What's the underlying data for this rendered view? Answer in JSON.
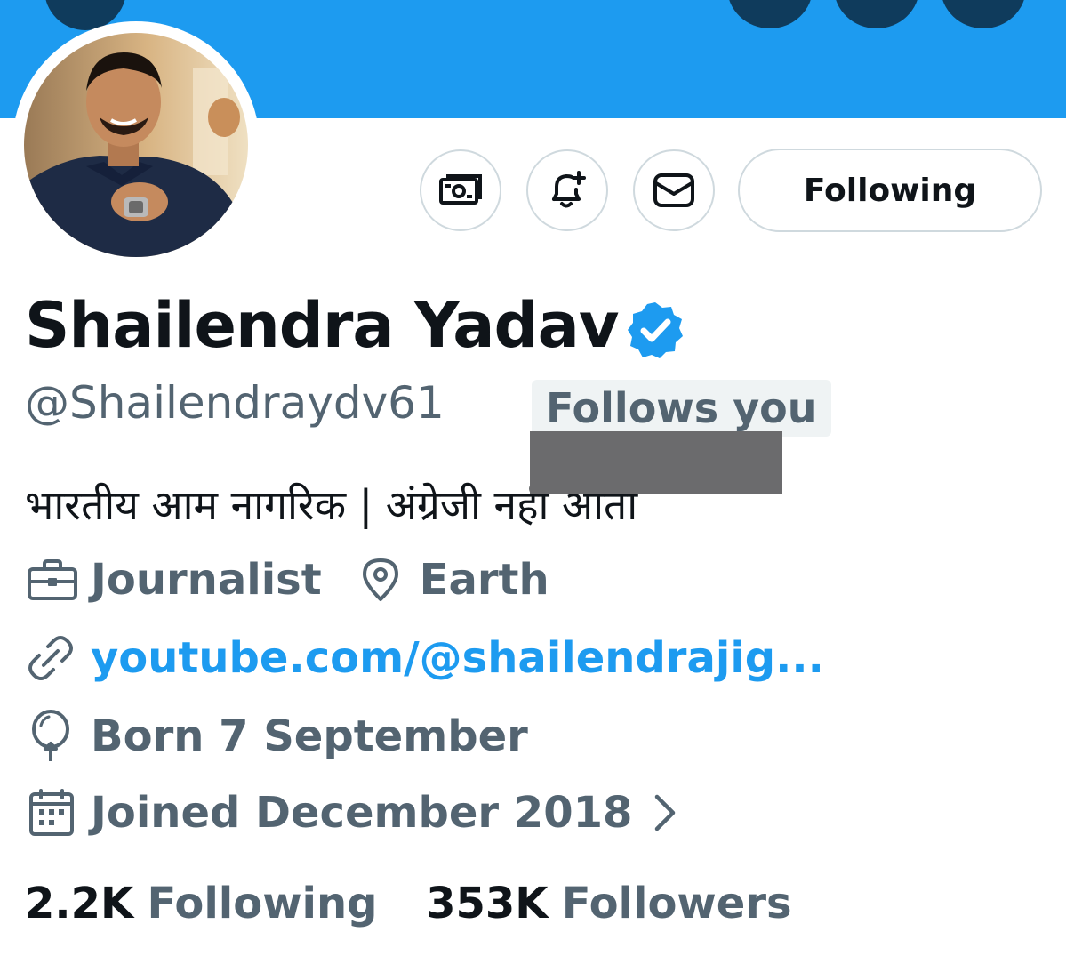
{
  "profile": {
    "name": "Shailendra Yadav",
    "handle": "@Shailendraydv61",
    "follows_you": "Follows you",
    "bio": "भारतीय आम नागरिक | अंग्रेजी नहीं आती",
    "profession": "Journalist",
    "location": "Earth",
    "link": "youtube.com/@shailendrajig...",
    "birthday": "Born 7 September",
    "joined": "Joined December 2018"
  },
  "actions": {
    "following_label": "Following"
  },
  "stats": {
    "following_count": "2.2K",
    "following_label": "Following",
    "followers_count": "353K",
    "followers_label": "Followers"
  },
  "icons": {
    "tip": "money-icon",
    "notify": "bell-plus-icon",
    "message": "envelope-icon",
    "verified": "verified-badge-icon",
    "profession": "briefcase-icon",
    "location": "location-pin-icon",
    "link": "link-icon",
    "birthday": "balloon-icon",
    "joined": "calendar-icon",
    "chevron": "chevron-right-icon"
  },
  "colors": {
    "banner": "#1d9bf0",
    "accent": "#1d9bf0",
    "secondary_text": "#536471",
    "primary_text": "#0f1419"
  }
}
